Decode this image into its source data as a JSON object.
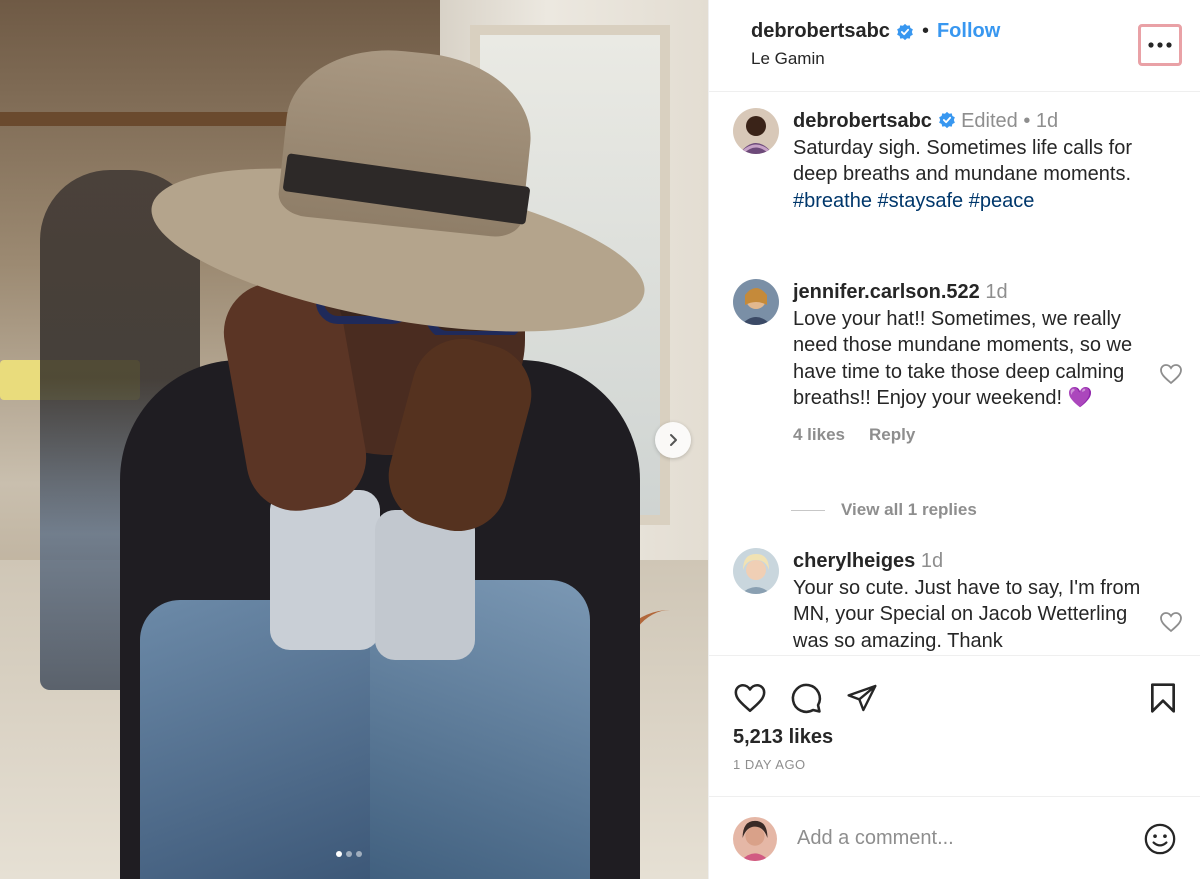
{
  "header": {
    "username": "debrobertsabc",
    "follow_label": "Follow",
    "location": "Le Gamin",
    "separator": "•"
  },
  "caption": {
    "username": "debrobertsabc",
    "edited_label": "Edited",
    "time": "1d",
    "text": "Saturday sigh. Sometimes life calls for deep breaths and mundane moments.",
    "hashtags": [
      "#breathe",
      "#staysafe",
      "#peace"
    ]
  },
  "comments": [
    {
      "username": "jennifer.carlson.522",
      "time": "1d",
      "text": "Love your hat!! Sometimes, we really need those mundane moments, so we have time to take those deep calming breaths!! Enjoy your weekend! 💜",
      "likes": "4 likes",
      "reply_label": "Reply"
    },
    {
      "username": "cherylheiges",
      "time": "1d",
      "text": "Your so cute. Just have to say, I'm from MN, your Special on Jacob Wetterling was so amazing. Thank"
    }
  ],
  "view_replies_label": "View all 1 replies",
  "post": {
    "likes": "5,213 likes",
    "date": "1 DAY AGO"
  },
  "add_comment": {
    "placeholder": "Add a comment..."
  },
  "carousel": {
    "slide_count": 3,
    "active_slide": 1
  },
  "colors": {
    "accent": "#3897f0",
    "hashtag": "#00376b",
    "muted": "#8e8e8e",
    "highlight_border": "#e9a1a6"
  },
  "icons": [
    "verified-badge-icon",
    "more-options-icon",
    "heart-icon",
    "comment-icon",
    "share-icon",
    "bookmark-icon",
    "emoji-icon",
    "chevron-right-icon"
  ]
}
